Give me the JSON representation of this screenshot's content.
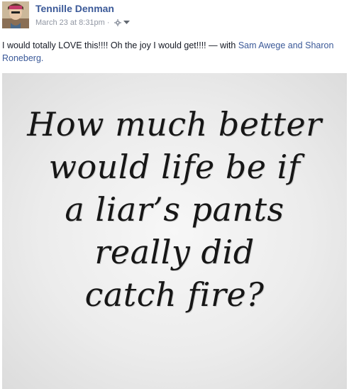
{
  "post": {
    "author_name": "Tennille Denman",
    "timestamp": "March 23 at 8:31pm",
    "separator": "·",
    "audience_icon": "gear-icon",
    "dropdown_icon": "chevron-down-icon",
    "message": "I would totally LOVE this!!!! Oh the joy I would get!!!! — with",
    "tagged_1": "Sam Awege",
    "conjunction": "and",
    "tagged_2": "Sharon Roneberg",
    "end_punct": "."
  },
  "photo": {
    "quote_lines": [
      "How much better",
      "would life be if",
      "a liar’s pants",
      "really did",
      "catch fire?"
    ]
  },
  "colors": {
    "link": "#3b5998",
    "meta": "#9197a3",
    "text": "#141823"
  }
}
